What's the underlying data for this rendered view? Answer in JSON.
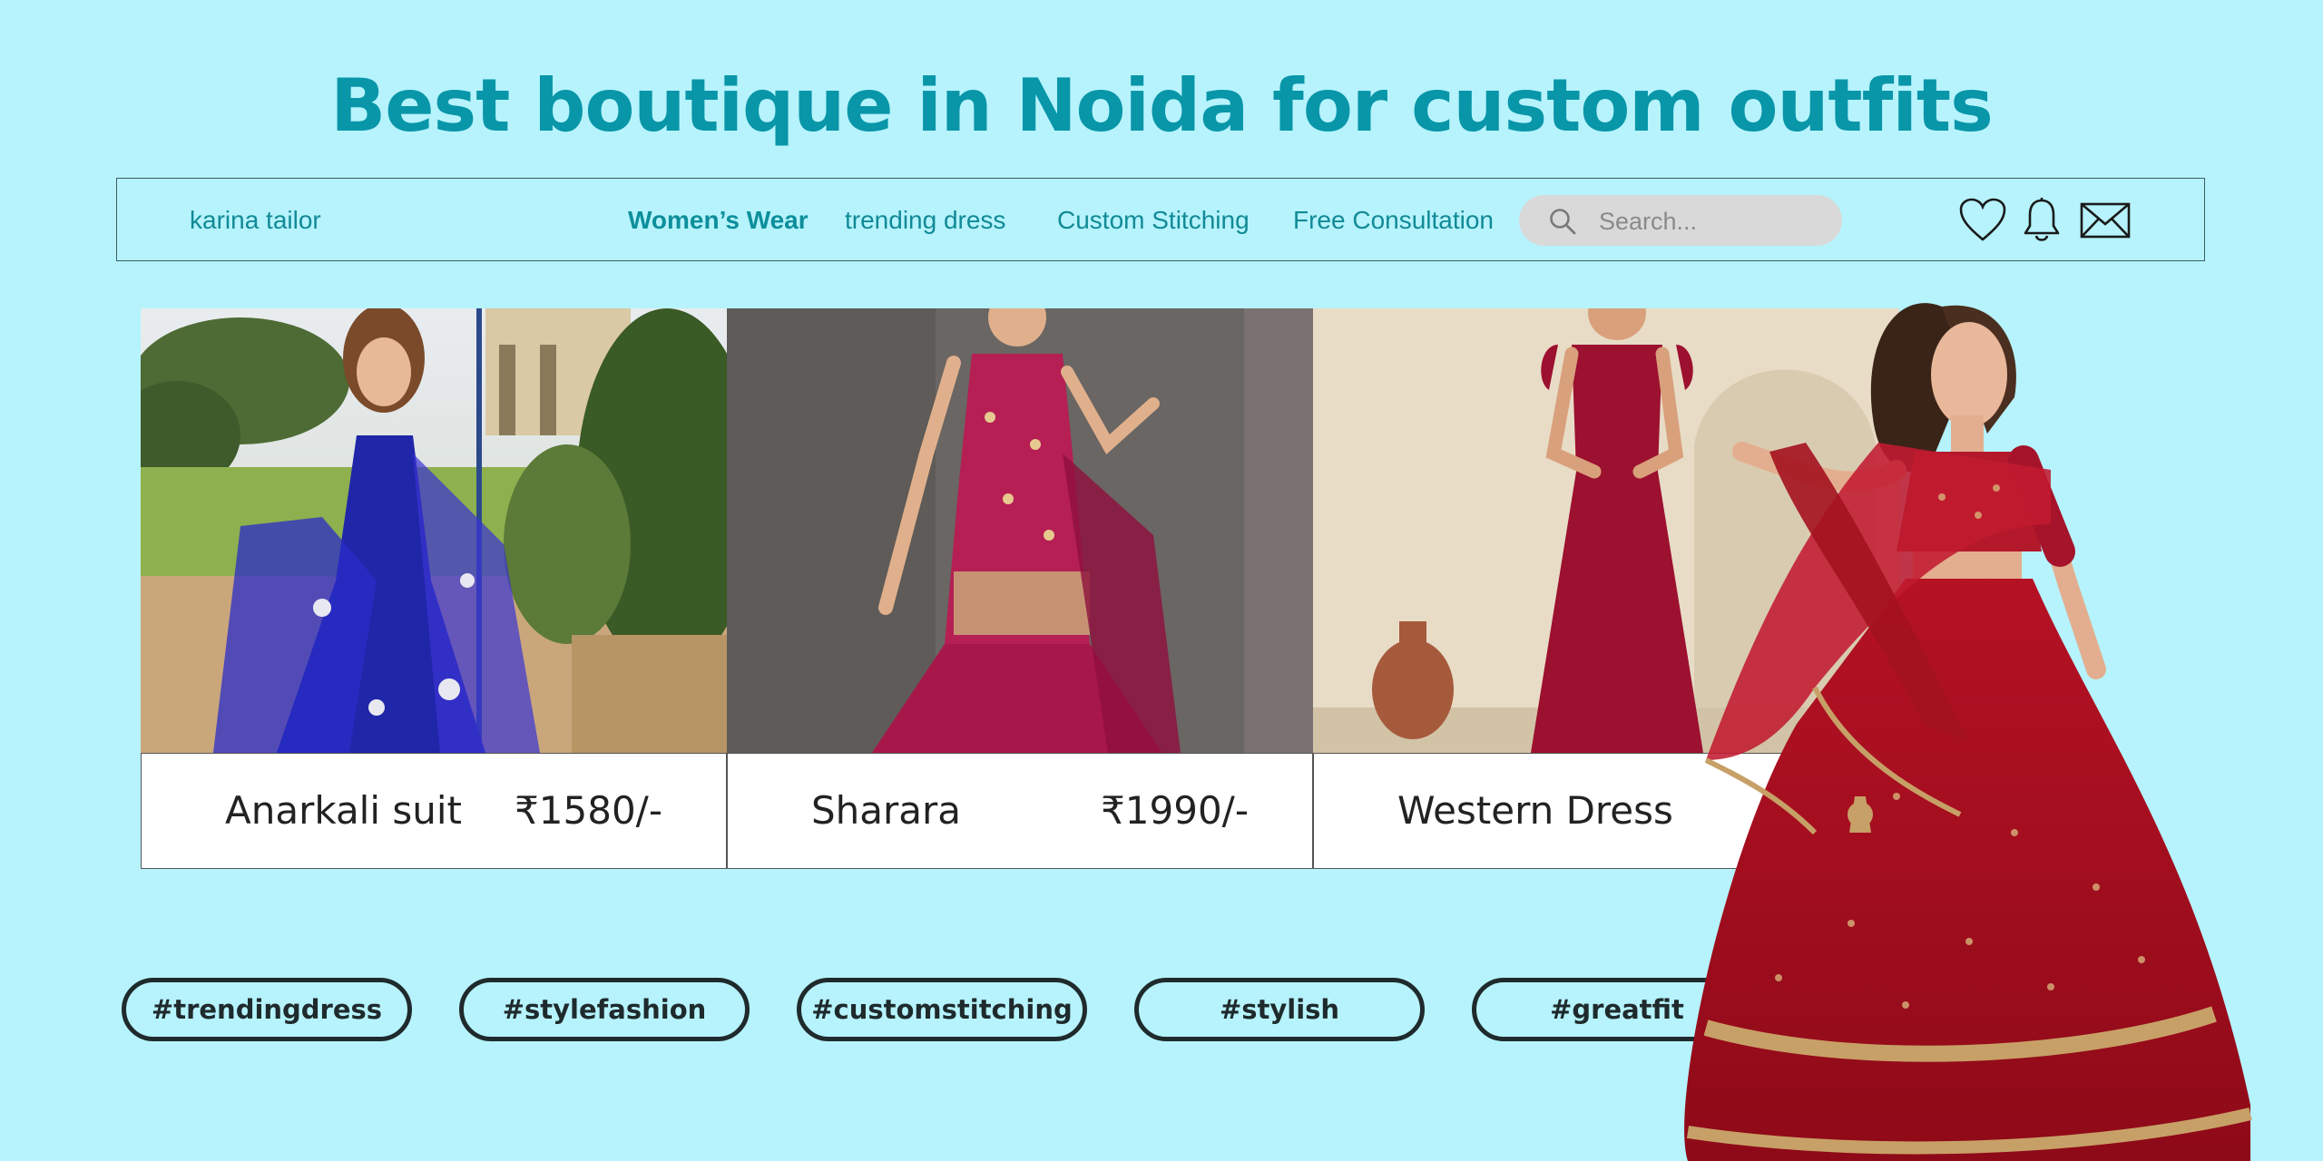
{
  "headline": "Best boutique in Noida for custom outfits",
  "nav": {
    "brand": "karina tailor",
    "items": [
      "Women’s Wear",
      "trending dress",
      "Custom Stitching",
      "Free Consultation"
    ],
    "search_placeholder": "Search...",
    "icons": [
      "heart-icon",
      "bell-icon",
      "mail-icon"
    ]
  },
  "products": [
    {
      "name": "Anarkali suit",
      "price": "₹1580/-"
    },
    {
      "name": "Sharara",
      "price": "₹1990/-"
    },
    {
      "name": "Western Dress",
      "price": ""
    }
  ],
  "tags": [
    "#trendingdress",
    "#stylefashion",
    "#customstitching",
    "#stylish",
    "#greatfit"
  ],
  "colors": {
    "background": "#b6f3fd",
    "headline": "#0896a8",
    "nav_text": "#118a96",
    "search_bg": "#d9d9d9",
    "tag_border": "#1f2a2c"
  }
}
